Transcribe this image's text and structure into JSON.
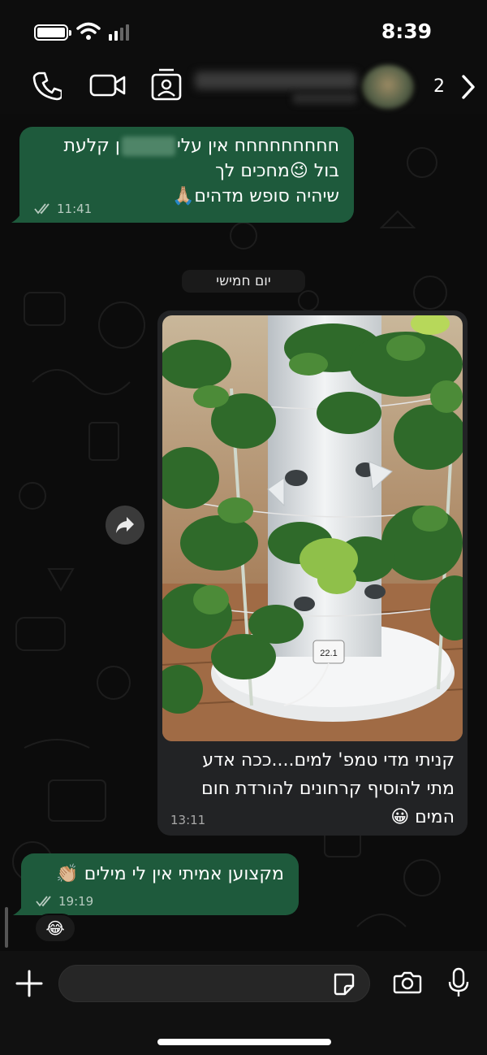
{
  "status_bar": {
    "time": "8:39"
  },
  "header": {
    "unread_count": "2"
  },
  "messages": [
    {
      "line1_prefix": "חחחחחחחחח אין עלי",
      "line1_suffix": "ן קלעת",
      "line2": "בול 😉מחכים לך",
      "line3": "שיהיה סופש מדהים🙏🏼",
      "time": "11:41"
    },
    {
      "caption_line1": "קניתי מדי טמפ' למים....ככה אדע",
      "caption_line2": "מתי להוסיף קרחונים להורדת חום",
      "caption_line3": "המים 😀",
      "time": "13:11",
      "thermometer_reading": "22.1"
    },
    {
      "text": "מקצוען אמיתי אין לי מילים 👏🏼",
      "time": "19:19",
      "reaction": "😂"
    }
  ],
  "date_separator": "יום חמישי",
  "composer": {
    "placeholder": "",
    "value": ""
  },
  "colors": {
    "outgoing_bubble": "#1e5a3c",
    "incoming_bubble": "#222325",
    "background": "#0c0c0c",
    "read_ticks": "#b8cbc0"
  },
  "icons": {
    "header": [
      "phone-icon",
      "video-camera-icon",
      "contact-card-icon",
      "chevron-right-icon"
    ],
    "composer": [
      "plus-icon",
      "sticker-icon",
      "camera-icon",
      "microphone-icon"
    ],
    "message": [
      "double-check-icon",
      "forward-icon"
    ]
  }
}
